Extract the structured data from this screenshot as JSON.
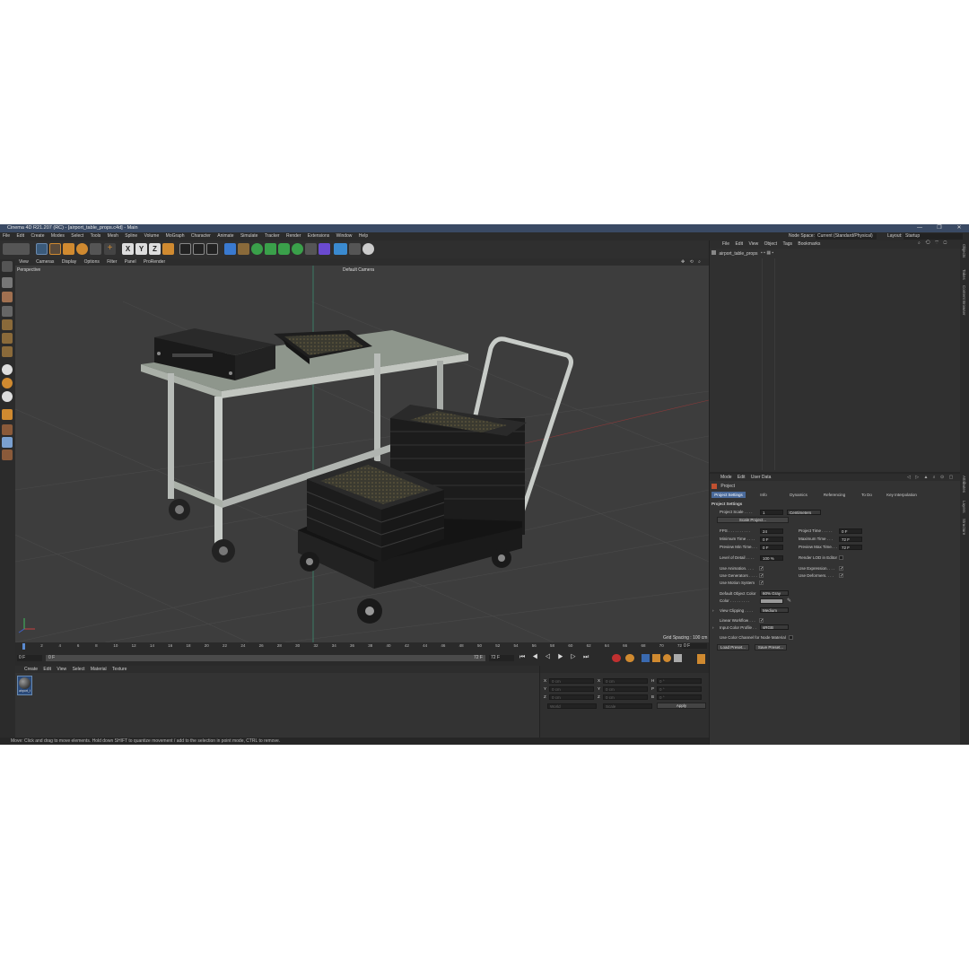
{
  "app": {
    "title": "Cinema 4D R21.207 (RC) - [airport_table_props.c4d] - Main",
    "window_controls": [
      "—",
      "❐",
      "✕"
    ]
  },
  "menu": [
    "File",
    "Edit",
    "Create",
    "Modes",
    "Select",
    "Tools",
    "Mesh",
    "Spline",
    "Volume",
    "MoGraph",
    "Character",
    "Animate",
    "Simulate",
    "Tracker",
    "Render",
    "Extensions",
    "Window",
    "Help"
  ],
  "node_space": {
    "label": "Node Space:",
    "value": "Current (Standard/Physical)"
  },
  "layout": {
    "label": "Layout:",
    "value": "Startup"
  },
  "toolbar_axes": [
    "X",
    "Y",
    "Z"
  ],
  "viewport": {
    "menu": [
      "View",
      "Cameras",
      "Display",
      "Options",
      "Filter",
      "Panel",
      "ProRender"
    ],
    "view_name": "Perspective",
    "camera": "Default Camera",
    "grid_spacing": "Grid Spacing : 100 cm"
  },
  "timeline": {
    "ticks": [
      "0",
      "2",
      "4",
      "6",
      "8",
      "10",
      "12",
      "14",
      "16",
      "18",
      "20",
      "22",
      "24",
      "26",
      "28",
      "30",
      "32",
      "34",
      "36",
      "38",
      "40",
      "42",
      "44",
      "46",
      "48",
      "50",
      "52",
      "54",
      "56",
      "58",
      "60",
      "62",
      "64",
      "66",
      "68",
      "70",
      "72"
    ],
    "current_frame": "0 F",
    "start": "0 F",
    "range_start": "0 F",
    "range_end": "72 F",
    "end": "72 F"
  },
  "material_panel": {
    "menu": [
      "Create",
      "Edit",
      "View",
      "Select",
      "Material",
      "Texture"
    ],
    "material_name": "airport_t"
  },
  "coordinates": {
    "rows": [
      {
        "a": "X",
        "av": "0 cm",
        "b": "X",
        "bv": "0 cm",
        "c": "H",
        "cv": "0 °"
      },
      {
        "a": "Y",
        "av": "0 cm",
        "b": "Y",
        "bv": "0 cm",
        "c": "P",
        "cv": "0 °"
      },
      {
        "a": "Z",
        "av": "0 cm",
        "b": "Z",
        "bv": "0 cm",
        "c": "B",
        "cv": "0 °"
      }
    ],
    "mode": "World",
    "scale_mode": "Scale",
    "apply": "Apply"
  },
  "status": "Move: Click and drag to move elements. Hold down SHIFT to quantize movement / add to the selection in point mode, CTRL to remove.",
  "object_manager": {
    "menu": [
      "File",
      "Edit",
      "View",
      "Object",
      "Tags",
      "Bookmarks"
    ],
    "object": "airport_table_props"
  },
  "attributes": {
    "menu": [
      "Mode",
      "Edit",
      "User Data"
    ],
    "object": "Project",
    "tabs": [
      "Project Settings",
      "Info",
      "Dynamics",
      "Referencing",
      "To Do",
      "Key Interpolation"
    ],
    "section": "Project Settings",
    "project_scale": {
      "label": "Project Scale . . . .",
      "value": "1",
      "unit": "Centimeters"
    },
    "scale_project": "Scale Project...",
    "fps": {
      "label": "FPS . . . . . . . . . .",
      "value": "24"
    },
    "project_time": {
      "label": "Project Time . . . . .",
      "value": "0 F"
    },
    "min_time": {
      "label": "Minimum Time . . . .",
      "value": "0 F"
    },
    "max_time": {
      "label": "Maximum Time . . .",
      "value": "72 F"
    },
    "preview_min": {
      "label": "Preview Min Time. . .",
      "value": "0 F"
    },
    "preview_max": {
      "label": "Preview Max Time. . .",
      "value": "72 F"
    },
    "lod": {
      "label": "Level of Detail . . . .",
      "value": "100 %"
    },
    "render_lod": "Render LOD in Editor",
    "use_animation": "Use Animation. . . .",
    "use_expression": "Use Expression. . . .",
    "use_generators": "Use Generators . . . .",
    "use_deformers": "Use Deformers. . . .",
    "use_motion": "Use Motion System",
    "default_color": {
      "label": "Default Object Color",
      "value": "60% Gray"
    },
    "color": {
      "label": "Color . . . . . . . . .",
      "swatch": "#9a9a9a"
    },
    "view_clipping": {
      "label": "View Clipping . . . .",
      "value": "Medium"
    },
    "linear_workflow": "Linear Workflow . . .",
    "input_color_profile": {
      "label": "Input Color Profile . .",
      "value": "sRGB"
    },
    "use_color_channel": "Use Color Channel for Node Material",
    "load_preset": "Load Preset...",
    "save_preset": "Save Preset..."
  },
  "right_strip": [
    "Objects",
    "Takes",
    "Content Browser",
    "Attributes",
    "Layers",
    "Structure"
  ]
}
